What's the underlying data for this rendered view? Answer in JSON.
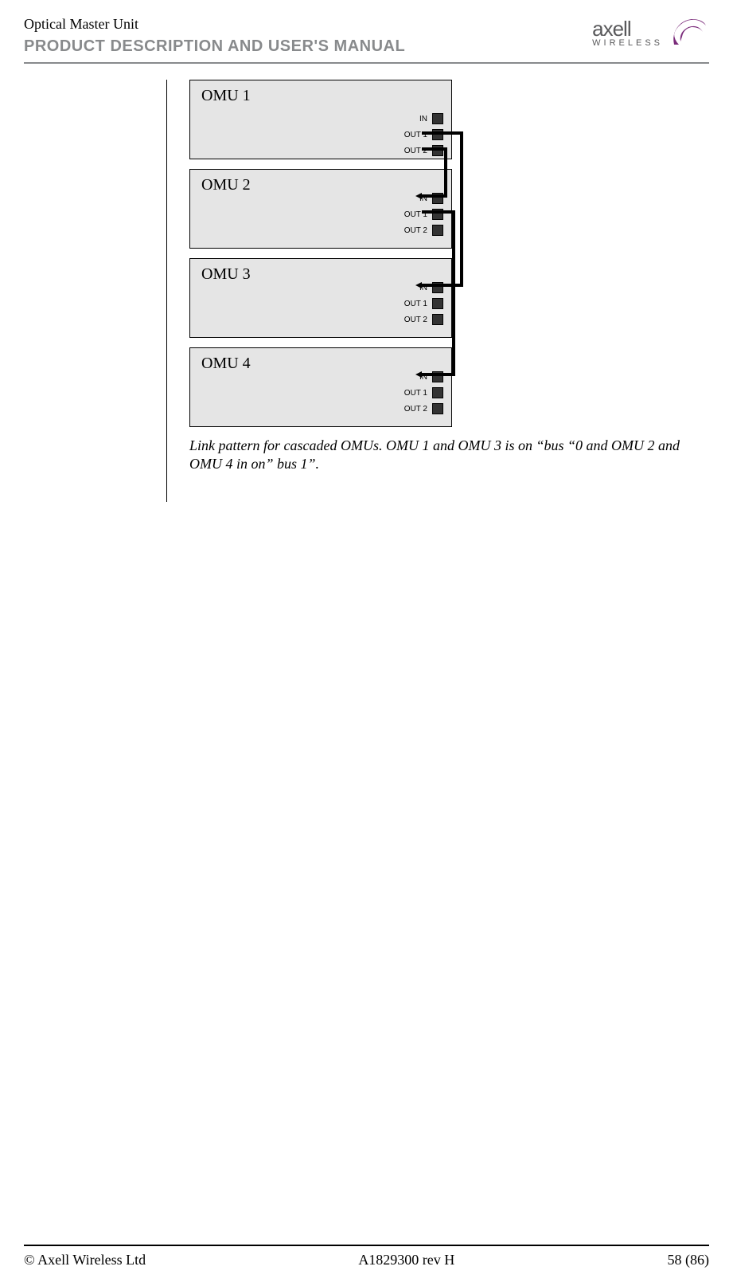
{
  "header": {
    "product_name": "Optical Master Unit",
    "manual_title": "PRODUCT DESCRIPTION AND USER'S MANUAL",
    "logo_brand": "axell",
    "logo_sub": "WIRELESS"
  },
  "diagram": {
    "units": [
      {
        "label": "OMU 1",
        "ports": [
          "IN",
          "OUT 1",
          "OUT 2"
        ]
      },
      {
        "label": "OMU 2",
        "ports": [
          "IN",
          "OUT 1",
          "OUT 2"
        ]
      },
      {
        "label": "OMU 3",
        "ports": [
          "IN",
          "OUT 1",
          "OUT 2"
        ]
      },
      {
        "label": "OMU 4",
        "ports": [
          "IN",
          "OUT 1",
          "OUT 2"
        ]
      }
    ],
    "caption": "Link pattern for cascaded OMUs. OMU 1 and OMU 3 is on “bus “0 and OMU  2 and OMU 4 in on” bus 1”."
  },
  "footer": {
    "left": "© Axell Wireless Ltd",
    "center": "A1829300 rev H",
    "right": "58 (86)"
  }
}
